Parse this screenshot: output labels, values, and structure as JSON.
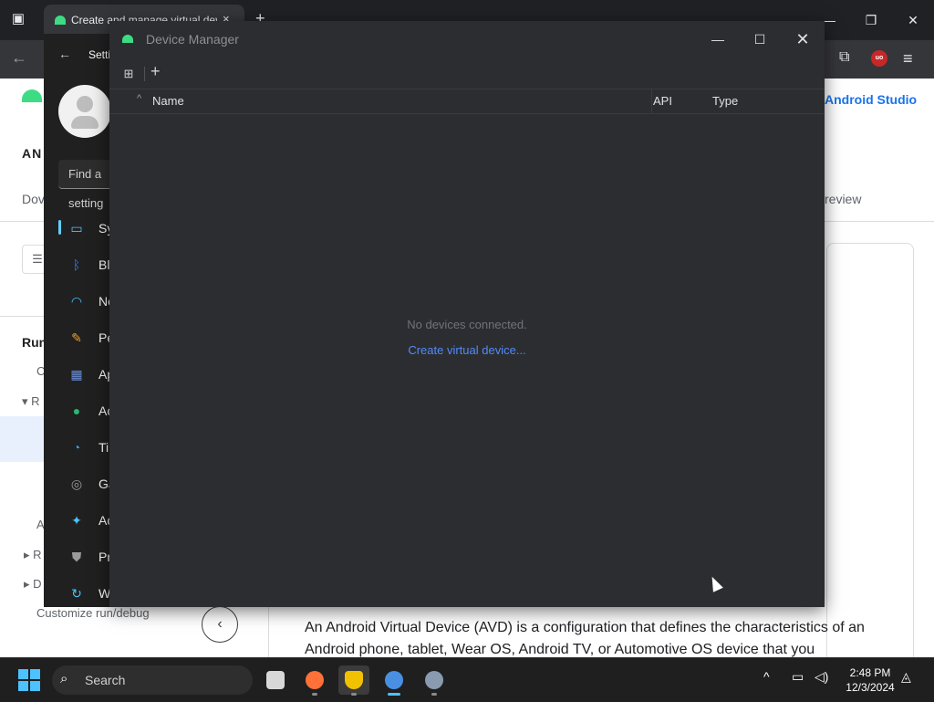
{
  "browser": {
    "tab_title": "Create and manage virtual dev",
    "tab_close": "×",
    "new_tab": "+",
    "back": "←",
    "ublock_badge": "uo"
  },
  "webpage": {
    "android_studio": "Android Studio",
    "section_an": "AN",
    "tab_dow": "Dov",
    "tab_preview": "review",
    "nav_run": "Run",
    "nav_c": "C",
    "nav_r1": "R",
    "nav_a": "A",
    "nav_r2": "R",
    "nav_d": "D",
    "customize": "Customize run/debug",
    "collapse": "‹",
    "paragraph": "An Android Virtual Device (AVD) is a configuration that defines the characteristics of an Android phone, tablet, Wear OS, Android TV, or Automotive OS device that you"
  },
  "settings": {
    "title": "Settings",
    "back": "←",
    "search_placeholder": "Find a setting",
    "items": [
      {
        "label": "System",
        "icon": "display-icon",
        "color": "#4cc2ff"
      },
      {
        "label": "Bluetooth & devices",
        "icon": "bluetooth-icon",
        "color": "#2f80ed"
      },
      {
        "label": "Network & internet",
        "icon": "wifi-icon",
        "color": "#4cc2ff"
      },
      {
        "label": "Personalization",
        "icon": "brush-icon",
        "color": "#e9a03b"
      },
      {
        "label": "Apps",
        "icon": "apps-icon",
        "color": "#6b8fd6"
      },
      {
        "label": "Accounts",
        "icon": "person-icon",
        "color": "#2bb673"
      },
      {
        "label": "Time & language",
        "icon": "globe-clock-icon",
        "color": "#3a96dd"
      },
      {
        "label": "Gaming",
        "icon": "gamepad-icon",
        "color": "#9a9a9a"
      },
      {
        "label": "Accessibility",
        "icon": "accessibility-icon",
        "color": "#4cc2ff"
      },
      {
        "label": "Privacy & security",
        "icon": "shield-icon",
        "color": "#9a9a9a"
      },
      {
        "label": "Windows Update",
        "icon": "update-icon",
        "color": "#4cc2ff"
      }
    ]
  },
  "device_manager": {
    "title": "Device Manager",
    "columns": {
      "name": "Name",
      "api": "API",
      "type": "Type"
    },
    "empty_message": "No devices connected.",
    "create_link": "Create virtual device..."
  },
  "taskbar": {
    "search": "Search",
    "time": "2:48 PM",
    "date": "12/3/2024",
    "apps": [
      "file-explorer-icon",
      "firefox-icon",
      "security-shield-icon",
      "android-studio-icon",
      "settings-gear-icon"
    ]
  },
  "colors": {
    "accent": "#548af7",
    "android_green": "#3ddc84",
    "dm_background": "#2b2d30"
  }
}
